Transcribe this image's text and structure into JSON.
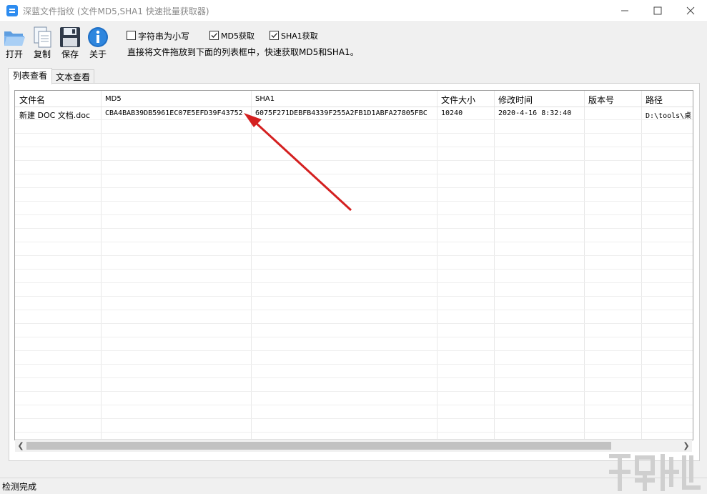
{
  "window": {
    "title": "深蓝文件指纹 (文件MD5,SHA1 快速批量获取器)"
  },
  "toolbar": {
    "open_label": "打开",
    "copy_label": "复制",
    "save_label": "保存",
    "about_label": "关于"
  },
  "options": {
    "lowercase": {
      "label": "字符串为小写",
      "checked": false
    },
    "md5": {
      "label": "MD5获取",
      "checked": true
    },
    "sha1": {
      "label": "SHA1获取",
      "checked": true
    },
    "hint": "直接将文件拖放到下面的列表框中，快速获取MD5和SHA1。"
  },
  "tabs": [
    "列表查看",
    "文本查看"
  ],
  "table": {
    "columns": [
      "文件名",
      "MD5",
      "SHA1",
      "文件大小",
      "修改时间",
      "版本号",
      "路径"
    ],
    "rows": [
      [
        "新建 DOC 文档.doc",
        "CBA4BAB39DB5961EC07E5EFD39F43752",
        "6075F271DEBFB4339F255A2FB1D1ABFA27805FBC",
        "10240",
        "2020-4-16 8:32:40",
        "",
        "D:\\tools\\桌"
      ]
    ]
  },
  "status": {
    "text": "检测完成"
  },
  "colors": {
    "arrow": "#d42020",
    "accent": "#2d8cf0"
  }
}
